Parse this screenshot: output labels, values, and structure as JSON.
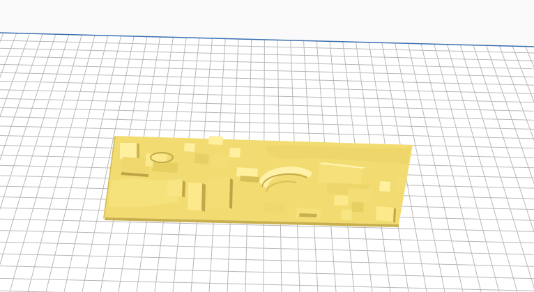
{
  "viewport": {
    "view": "3d-build-plate",
    "background_color": "#fafafa",
    "plate_color": "#ffffff",
    "grid_color": "#b8b8b8",
    "plate_edge_color": "#3a6fb0"
  },
  "model": {
    "kind": "city-relief-plate",
    "color": "#f5e27a",
    "shadow_color": "#d9c25a",
    "highlight_color": "#fff3a6"
  }
}
